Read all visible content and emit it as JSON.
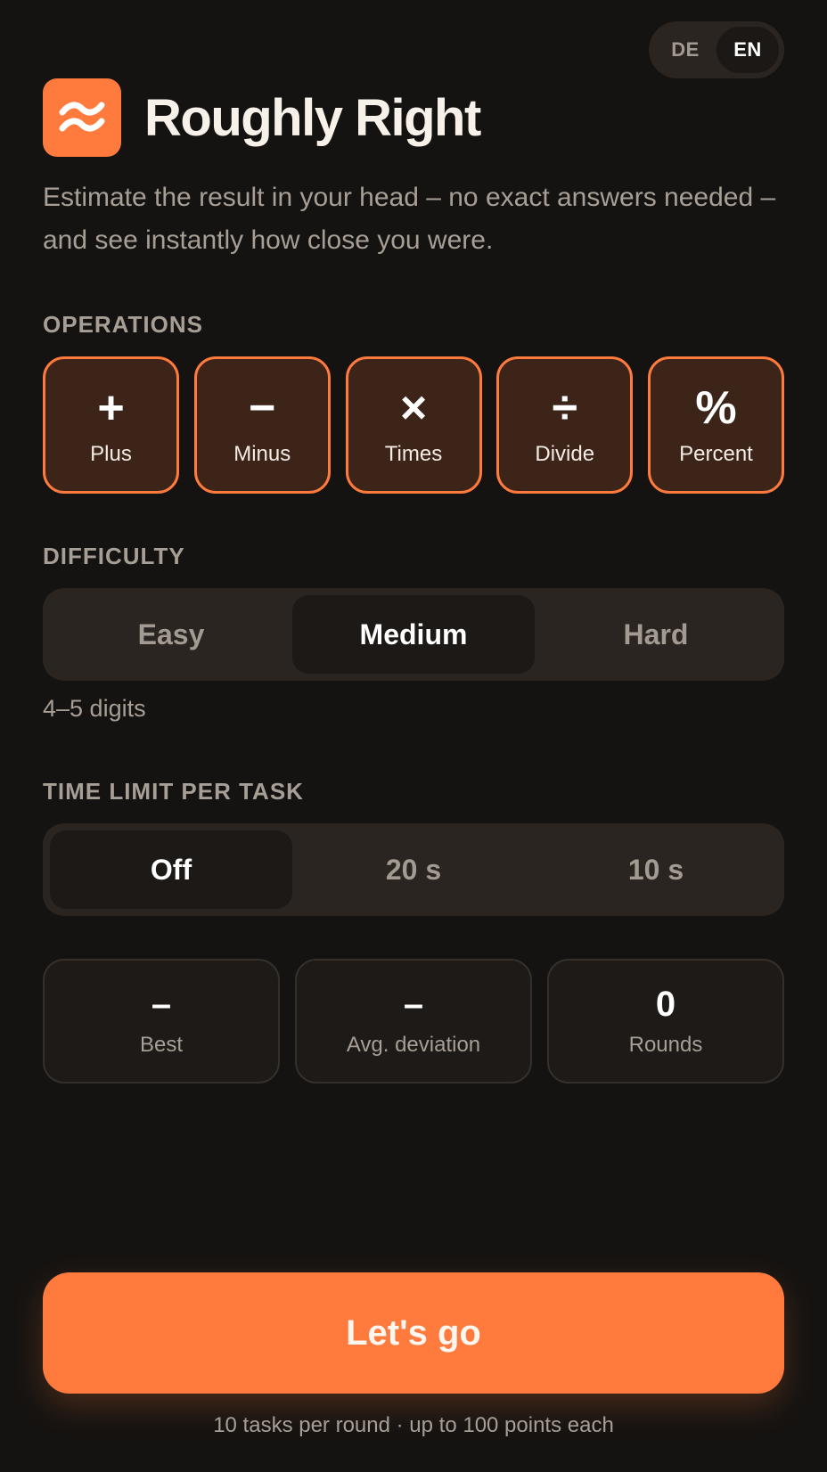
{
  "lang": {
    "options": [
      "DE",
      "EN"
    ],
    "selected": "EN"
  },
  "header": {
    "title": "Roughly Right",
    "logo_icon": "approx-icon"
  },
  "subtitle": "Estimate the result in your head – no exact answers needed – and see instantly how close you were.",
  "operations": {
    "label": "OPERATIONS",
    "items": [
      {
        "symbol": "+",
        "label": "Plus",
        "selected": true
      },
      {
        "symbol": "−",
        "label": "Minus",
        "selected": true
      },
      {
        "symbol": "×",
        "label": "Times",
        "selected": true
      },
      {
        "symbol": "÷",
        "label": "Divide",
        "selected": true
      },
      {
        "symbol": "%",
        "label": "Percent",
        "selected": true
      }
    ]
  },
  "difficulty": {
    "label": "DIFFICULTY",
    "options": [
      "Easy",
      "Medium",
      "Hard"
    ],
    "selected": "Medium",
    "hint": "4–5 digits"
  },
  "time_limit": {
    "label": "TIME LIMIT PER TASK",
    "options": [
      "Off",
      "20 s",
      "10 s"
    ],
    "selected": "Off"
  },
  "stats": [
    {
      "value": "–",
      "label": "Best"
    },
    {
      "value": "–",
      "label": "Avg. deviation"
    },
    {
      "value": "0",
      "label": "Rounds"
    }
  ],
  "cta": {
    "label": "Let's go"
  },
  "footer": "10 tasks per round · up to 100 points each",
  "colors": {
    "accent": "#ff7a3d",
    "background": "#151311",
    "surface": "#2a2521"
  }
}
